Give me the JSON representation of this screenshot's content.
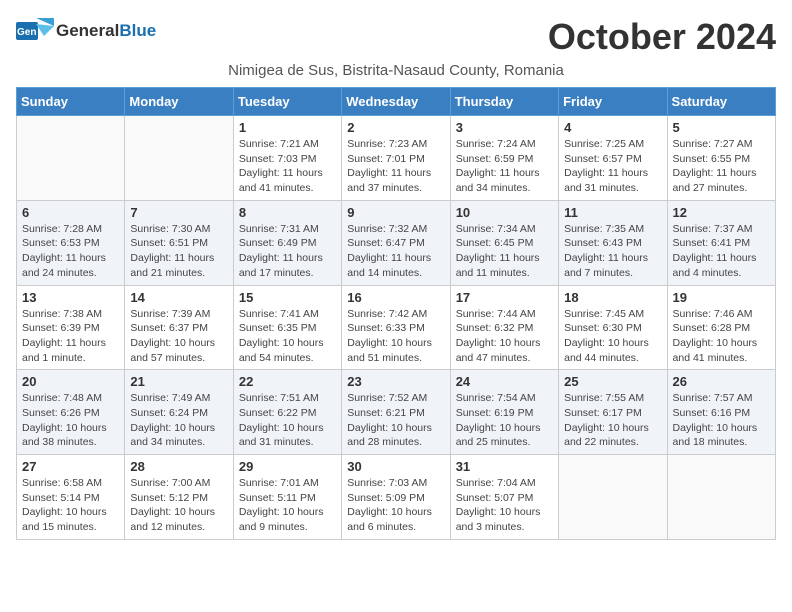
{
  "logo": {
    "general": "General",
    "blue": "Blue"
  },
  "title": "October 2024",
  "subtitle": "Nimigea de Sus, Bistrita-Nasaud County, Romania",
  "weekdays": [
    "Sunday",
    "Monday",
    "Tuesday",
    "Wednesday",
    "Thursday",
    "Friday",
    "Saturday"
  ],
  "weeks": [
    [
      {
        "day": "",
        "info": ""
      },
      {
        "day": "",
        "info": ""
      },
      {
        "day": "1",
        "info": "Sunrise: 7:21 AM\nSunset: 7:03 PM\nDaylight: 11 hours and 41 minutes."
      },
      {
        "day": "2",
        "info": "Sunrise: 7:23 AM\nSunset: 7:01 PM\nDaylight: 11 hours and 37 minutes."
      },
      {
        "day": "3",
        "info": "Sunrise: 7:24 AM\nSunset: 6:59 PM\nDaylight: 11 hours and 34 minutes."
      },
      {
        "day": "4",
        "info": "Sunrise: 7:25 AM\nSunset: 6:57 PM\nDaylight: 11 hours and 31 minutes."
      },
      {
        "day": "5",
        "info": "Sunrise: 7:27 AM\nSunset: 6:55 PM\nDaylight: 11 hours and 27 minutes."
      }
    ],
    [
      {
        "day": "6",
        "info": "Sunrise: 7:28 AM\nSunset: 6:53 PM\nDaylight: 11 hours and 24 minutes."
      },
      {
        "day": "7",
        "info": "Sunrise: 7:30 AM\nSunset: 6:51 PM\nDaylight: 11 hours and 21 minutes."
      },
      {
        "day": "8",
        "info": "Sunrise: 7:31 AM\nSunset: 6:49 PM\nDaylight: 11 hours and 17 minutes."
      },
      {
        "day": "9",
        "info": "Sunrise: 7:32 AM\nSunset: 6:47 PM\nDaylight: 11 hours and 14 minutes."
      },
      {
        "day": "10",
        "info": "Sunrise: 7:34 AM\nSunset: 6:45 PM\nDaylight: 11 hours and 11 minutes."
      },
      {
        "day": "11",
        "info": "Sunrise: 7:35 AM\nSunset: 6:43 PM\nDaylight: 11 hours and 7 minutes."
      },
      {
        "day": "12",
        "info": "Sunrise: 7:37 AM\nSunset: 6:41 PM\nDaylight: 11 hours and 4 minutes."
      }
    ],
    [
      {
        "day": "13",
        "info": "Sunrise: 7:38 AM\nSunset: 6:39 PM\nDaylight: 11 hours and 1 minute."
      },
      {
        "day": "14",
        "info": "Sunrise: 7:39 AM\nSunset: 6:37 PM\nDaylight: 10 hours and 57 minutes."
      },
      {
        "day": "15",
        "info": "Sunrise: 7:41 AM\nSunset: 6:35 PM\nDaylight: 10 hours and 54 minutes."
      },
      {
        "day": "16",
        "info": "Sunrise: 7:42 AM\nSunset: 6:33 PM\nDaylight: 10 hours and 51 minutes."
      },
      {
        "day": "17",
        "info": "Sunrise: 7:44 AM\nSunset: 6:32 PM\nDaylight: 10 hours and 47 minutes."
      },
      {
        "day": "18",
        "info": "Sunrise: 7:45 AM\nSunset: 6:30 PM\nDaylight: 10 hours and 44 minutes."
      },
      {
        "day": "19",
        "info": "Sunrise: 7:46 AM\nSunset: 6:28 PM\nDaylight: 10 hours and 41 minutes."
      }
    ],
    [
      {
        "day": "20",
        "info": "Sunrise: 7:48 AM\nSunset: 6:26 PM\nDaylight: 10 hours and 38 minutes."
      },
      {
        "day": "21",
        "info": "Sunrise: 7:49 AM\nSunset: 6:24 PM\nDaylight: 10 hours and 34 minutes."
      },
      {
        "day": "22",
        "info": "Sunrise: 7:51 AM\nSunset: 6:22 PM\nDaylight: 10 hours and 31 minutes."
      },
      {
        "day": "23",
        "info": "Sunrise: 7:52 AM\nSunset: 6:21 PM\nDaylight: 10 hours and 28 minutes."
      },
      {
        "day": "24",
        "info": "Sunrise: 7:54 AM\nSunset: 6:19 PM\nDaylight: 10 hours and 25 minutes."
      },
      {
        "day": "25",
        "info": "Sunrise: 7:55 AM\nSunset: 6:17 PM\nDaylight: 10 hours and 22 minutes."
      },
      {
        "day": "26",
        "info": "Sunrise: 7:57 AM\nSunset: 6:16 PM\nDaylight: 10 hours and 18 minutes."
      }
    ],
    [
      {
        "day": "27",
        "info": "Sunrise: 6:58 AM\nSunset: 5:14 PM\nDaylight: 10 hours and 15 minutes."
      },
      {
        "day": "28",
        "info": "Sunrise: 7:00 AM\nSunset: 5:12 PM\nDaylight: 10 hours and 12 minutes."
      },
      {
        "day": "29",
        "info": "Sunrise: 7:01 AM\nSunset: 5:11 PM\nDaylight: 10 hours and 9 minutes."
      },
      {
        "day": "30",
        "info": "Sunrise: 7:03 AM\nSunset: 5:09 PM\nDaylight: 10 hours and 6 minutes."
      },
      {
        "day": "31",
        "info": "Sunrise: 7:04 AM\nSunset: 5:07 PM\nDaylight: 10 hours and 3 minutes."
      },
      {
        "day": "",
        "info": ""
      },
      {
        "day": "",
        "info": ""
      }
    ]
  ]
}
